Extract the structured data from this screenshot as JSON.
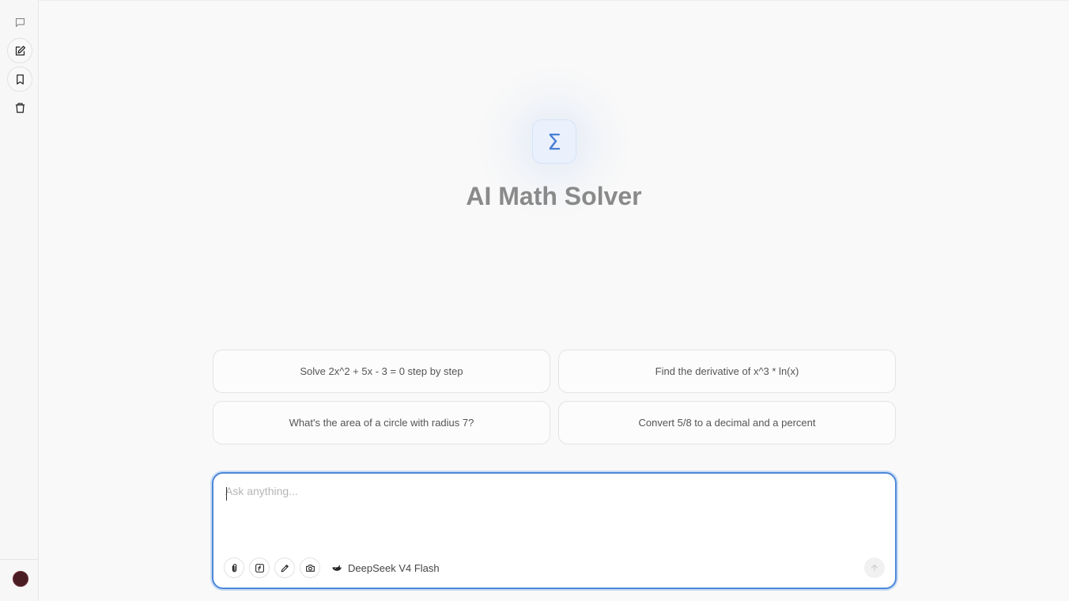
{
  "app": {
    "title": "AI Math Solver",
    "logo_symbol": "Σ"
  },
  "sidebar": {
    "items": [
      {
        "name": "chat-history",
        "icon": "message-square-icon"
      },
      {
        "name": "new-chat",
        "icon": "edit-icon"
      },
      {
        "name": "bookmarks",
        "icon": "bookmark-icon"
      },
      {
        "name": "delete",
        "icon": "trash-icon"
      }
    ],
    "avatar_color": "#4a1d23"
  },
  "suggestions": [
    "Solve 2x^2 + 5x - 3 = 0 step by step",
    "Find the derivative of x^3 * ln(x)",
    "What's the area of a circle with radius 7?",
    "Convert 5/8 to a decimal and a percent"
  ],
  "composer": {
    "placeholder": "Ask anything...",
    "value": "",
    "tools": [
      "paperclip-icon",
      "function-icon",
      "pen-icon",
      "camera-icon"
    ],
    "model_label": "DeepSeek V4 Flash",
    "model_icon": "whale-icon"
  },
  "colors": {
    "accent": "#4d88d8",
    "title": "#8a8a8a",
    "logo": "#4a7fd4"
  }
}
